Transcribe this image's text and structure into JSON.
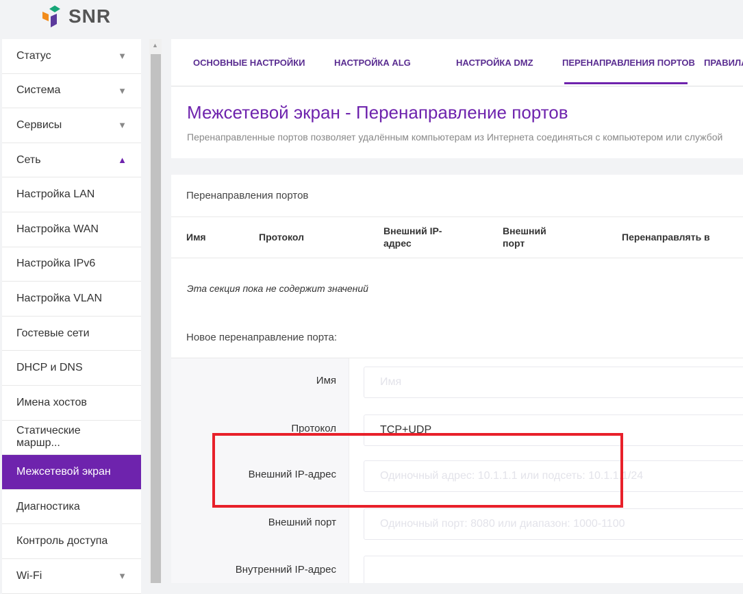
{
  "logo": {
    "text": "SNR"
  },
  "sidebar": {
    "items": [
      {
        "label": "Статус",
        "arrow": "▼"
      },
      {
        "label": "Система",
        "arrow": "▼"
      },
      {
        "label": "Сервисы",
        "arrow": "▼"
      },
      {
        "label": "Сеть",
        "arrow": "▲"
      },
      {
        "label": "Настройка LAN"
      },
      {
        "label": "Настройка WAN"
      },
      {
        "label": "Настройка IPv6"
      },
      {
        "label": "Настройка VLAN"
      },
      {
        "label": "Гостевые сети"
      },
      {
        "label": "DHCP и DNS"
      },
      {
        "label": "Имена хостов"
      },
      {
        "label": "Статические маршр..."
      },
      {
        "label": "Межсетевой экран",
        "active": true
      },
      {
        "label": "Диагностика"
      },
      {
        "label": "Контроль доступа"
      },
      {
        "label": "Wi-Fi",
        "arrow": "▼"
      }
    ]
  },
  "tabs": [
    "ОСНОВНЫЕ НАСТРОЙКИ",
    "НАСТРОЙКА ALG",
    "НАСТРОЙКА DMZ",
    "ПЕРЕНАПРАВЛЕНИЯ ПОРТОВ",
    "ПРАВИЛА"
  ],
  "header": {
    "title": "Межсетевой экран - Перенаправление портов",
    "description": "Перенаправленные портов позволяет удалённым компьютерам из Интернета соединяться с компьютером или службой"
  },
  "section": {
    "title": "Перенаправления портов",
    "columns": [
      "Имя",
      "Протокол",
      "Внешний IP-адрес",
      "Внешний порт",
      "Перенаправлять в"
    ],
    "empty": "Эта секция пока не содержит значений",
    "new_title": "Новое перенаправление порта:"
  },
  "form": {
    "name_label": "Имя",
    "name_placeholder": "Имя",
    "protocol_label": "Протокол",
    "protocol_value": "TCP+UDP",
    "ext_ip_label": "Внешний IP-адрес",
    "ext_ip_placeholder": "Одиночный адрес: 10.1.1.1 или подсеть: 10.1.1.1/24",
    "ext_port_label": "Внешний порт",
    "ext_port_placeholder": "Одиночный порт: 8080 или диапазон: 1000-1100",
    "int_ip_label": "Внутренний IP-адрес"
  },
  "colors": {
    "accent": "#6e23ad",
    "highlight": "#e8202a"
  }
}
